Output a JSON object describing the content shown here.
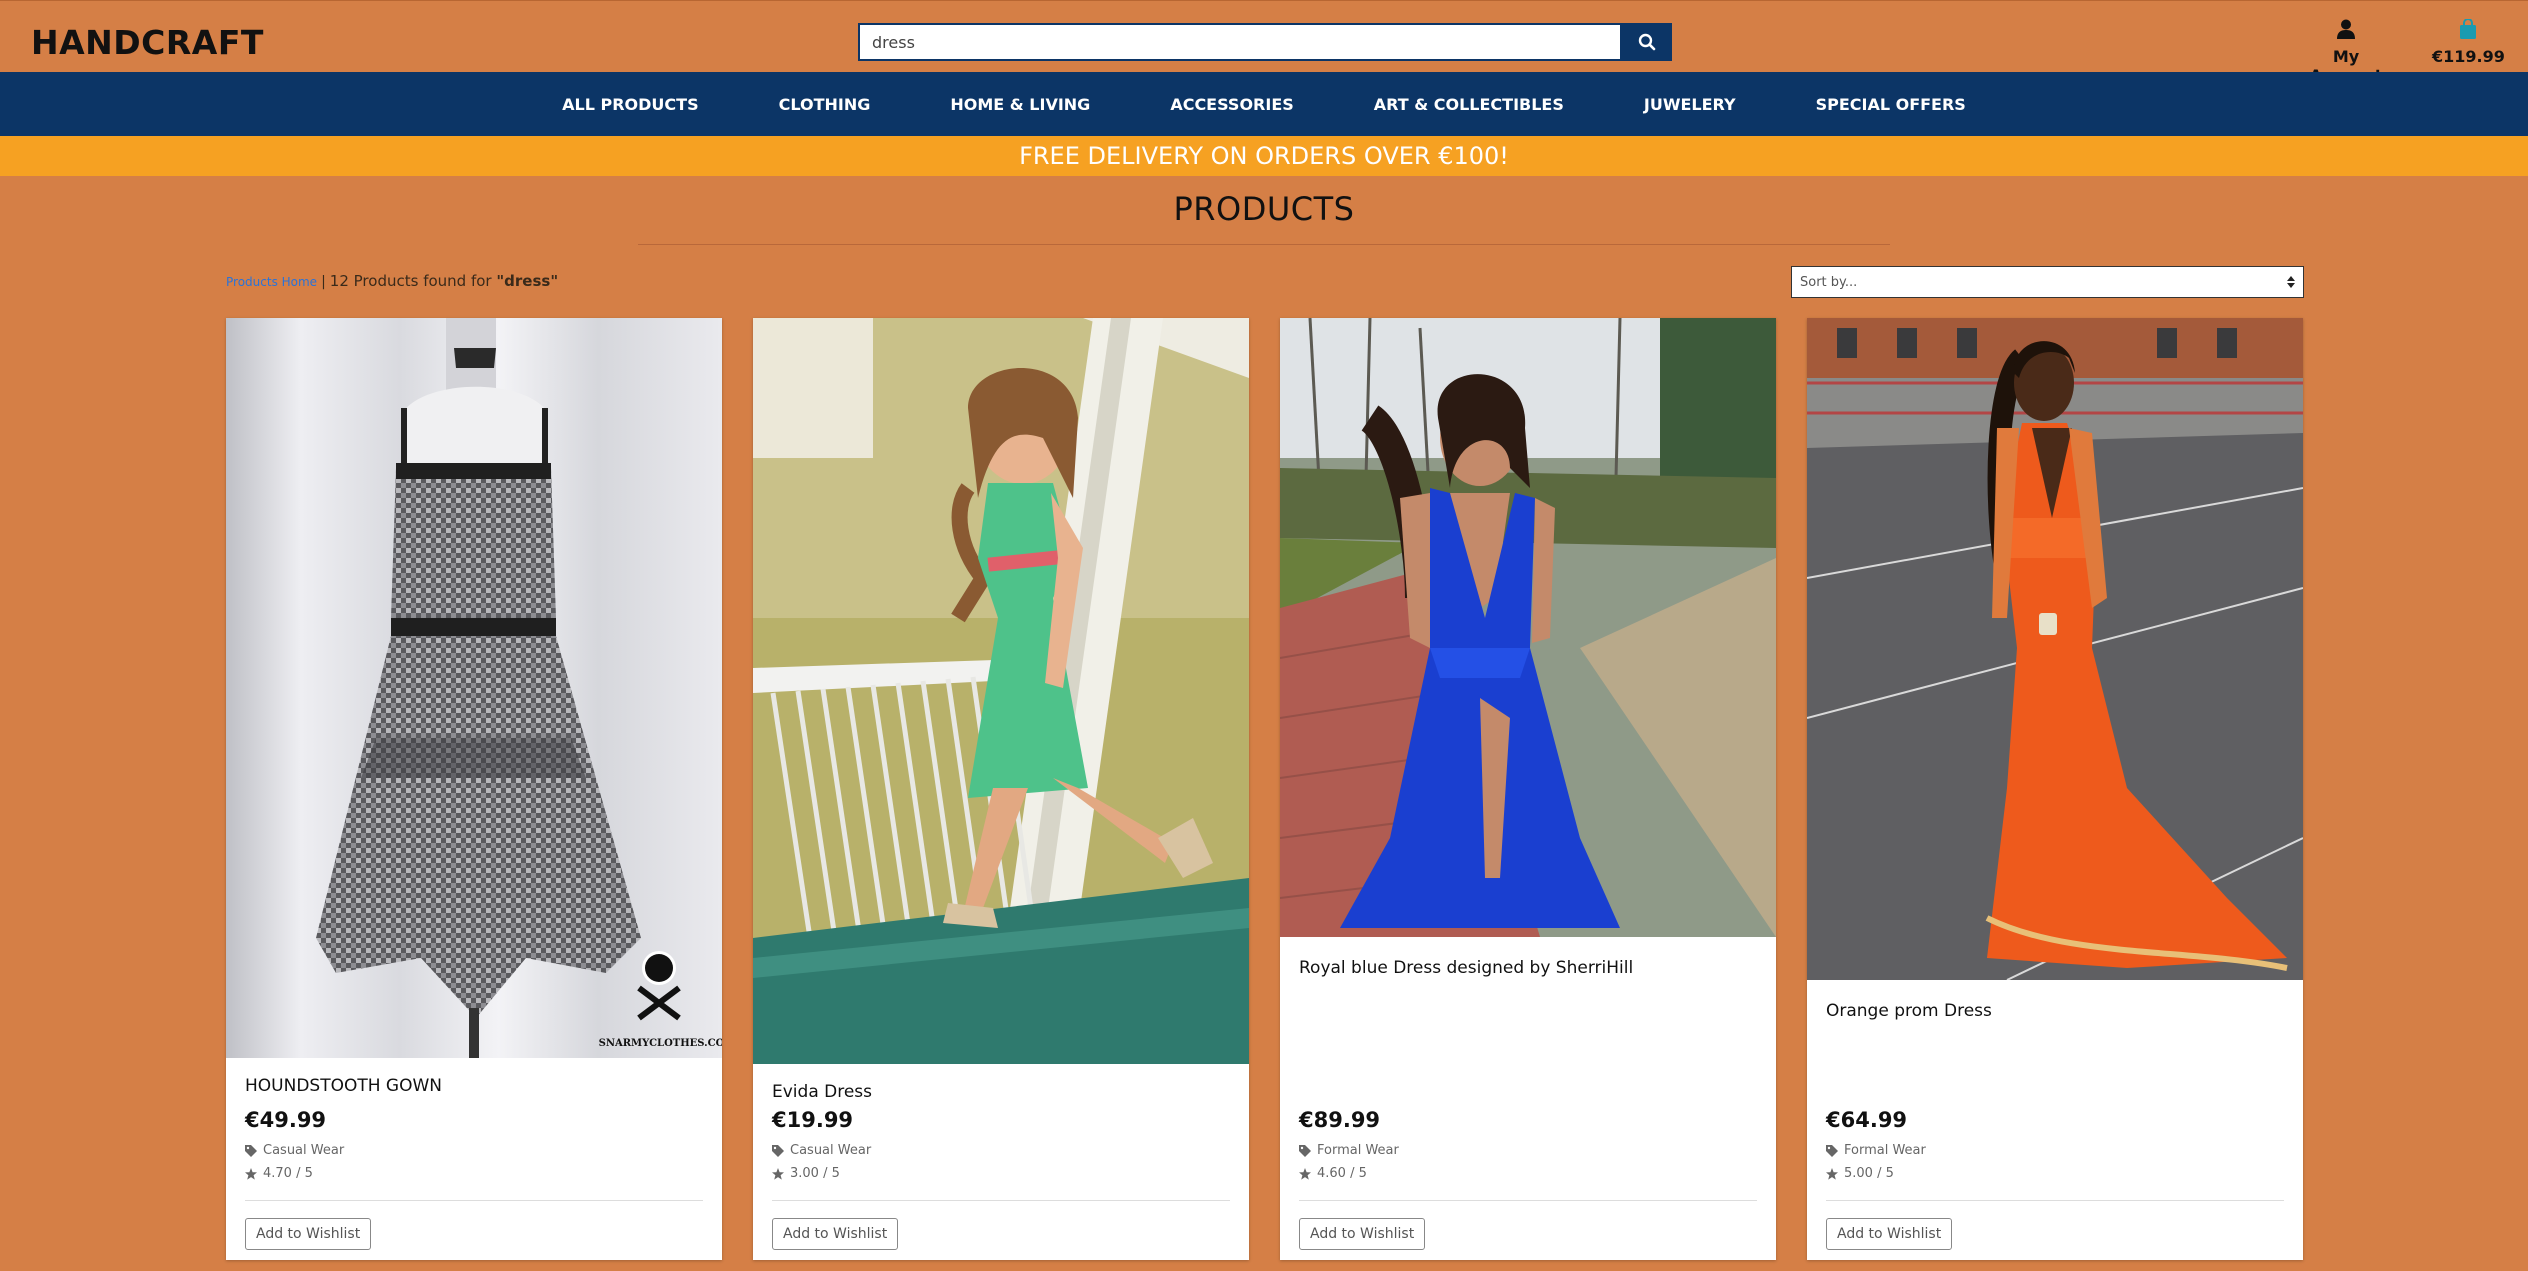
{
  "header": {
    "logo": "HANDCRAFT",
    "search_value": "dress",
    "account_label": "My Account",
    "cart_total": "€119.99"
  },
  "nav": {
    "items": [
      {
        "label": "ALL PRODUCTS"
      },
      {
        "label": "CLOTHING"
      },
      {
        "label": "HOME & LIVING"
      },
      {
        "label": "ACCESSORIES"
      },
      {
        "label": "ART & COLLECTIBLES"
      },
      {
        "label": "JUWELERY"
      },
      {
        "label": "SPECIAL OFFERS"
      }
    ]
  },
  "promo": "FREE DELIVERY ON ORDERS OVER €100!",
  "page_title": "PRODUCTS",
  "breadcrumb": {
    "home": "Products Home",
    "separator": "|",
    "count_text": "12 Products found for",
    "query": "\"dress\""
  },
  "sort": {
    "placeholder": "Sort by..."
  },
  "products": [
    {
      "name": "HOUNDSTOOTH GOWN",
      "price": "€49.99",
      "category": "Casual Wear",
      "rating": "4.70 / 5",
      "wishlist": "Add to Wishlist",
      "watermark": "SNARMYCLOTHES.COM"
    },
    {
      "name": "Evida Dress",
      "price": "€19.99",
      "category": "Casual Wear",
      "rating": "3.00 / 5",
      "wishlist": "Add to Wishlist"
    },
    {
      "name": "Royal blue Dress designed by SherriHill",
      "price": "€89.99",
      "category": "Formal Wear",
      "rating": "4.60 / 5",
      "wishlist": "Add to Wishlist"
    },
    {
      "name": "Orange prom Dress",
      "price": "€64.99",
      "category": "Formal Wear",
      "rating": "5.00 / 5",
      "wishlist": "Add to Wishlist"
    }
  ],
  "colors": {
    "background": "#d57f46",
    "nav": "#0c3566",
    "promo": "#f6a122",
    "link": "#2a73d8"
  }
}
